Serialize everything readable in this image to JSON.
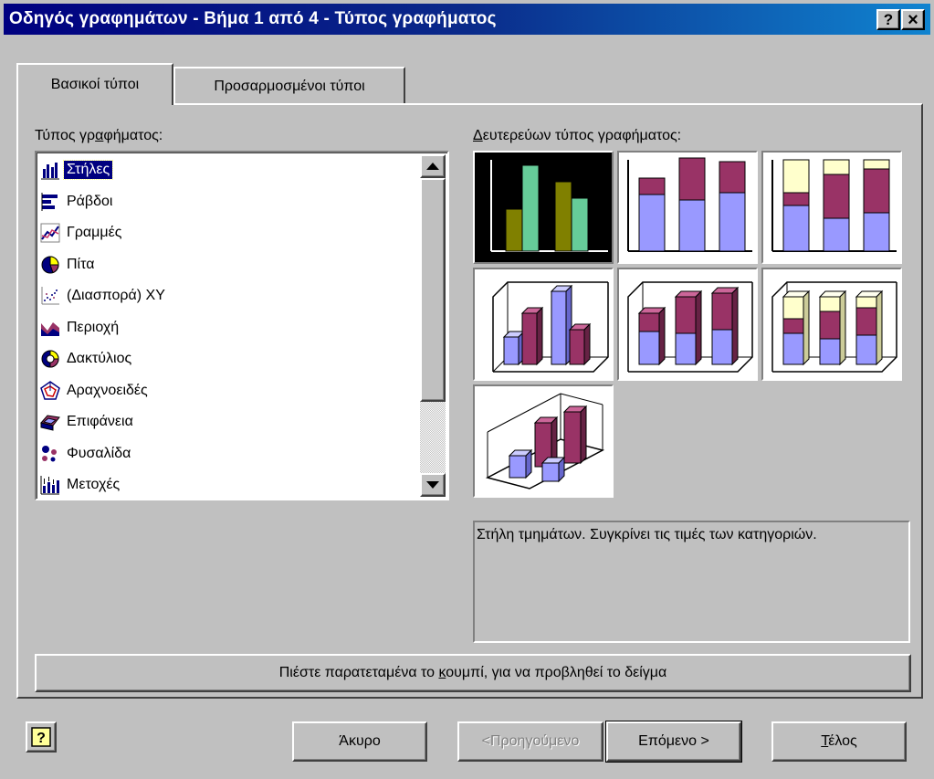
{
  "window": {
    "title": "Οδηγός γραφημάτων - Βήμα 1 από 4 - Τύπος γραφήματος",
    "help_button": "?",
    "close_button": "×"
  },
  "tabs": [
    {
      "label": "Βασικοί τύποι",
      "active": true
    },
    {
      "label": "Προσαρμοσμένοι τύποι",
      "active": false
    }
  ],
  "chart_type": {
    "label_pre": "Τύπος γρ",
    "label_accel": "α",
    "label_post": "φήματος:",
    "items": [
      {
        "label": "Στήλες",
        "icon": "column-chart-icon",
        "selected": true
      },
      {
        "label": "Ράβδοι",
        "icon": "bar-chart-icon"
      },
      {
        "label": "Γραμμές",
        "icon": "line-chart-icon"
      },
      {
        "label": "Πίτα",
        "icon": "pie-chart-icon"
      },
      {
        "label": "(Διασπορά) XY",
        "icon": "scatter-chart-icon"
      },
      {
        "label": "Περιοχή",
        "icon": "area-chart-icon"
      },
      {
        "label": "Δακτύλιος",
        "icon": "doughnut-chart-icon"
      },
      {
        "label": "Αραχνοειδές",
        "icon": "radar-chart-icon"
      },
      {
        "label": "Επιφάνεια",
        "icon": "surface-chart-icon"
      },
      {
        "label": "Φυσαλίδα",
        "icon": "bubble-chart-icon"
      },
      {
        "label": "Μετοχές",
        "icon": "stock-chart-icon"
      }
    ]
  },
  "subtype": {
    "label_accel": "Δ",
    "label_post": "ευτερεύων τύπος γραφήματος:",
    "tiles": [
      {
        "icon": "clustered-column-icon",
        "selected": true
      },
      {
        "icon": "stacked-column-icon"
      },
      {
        "icon": "100-stacked-column-icon"
      },
      {
        "icon": "3d-clustered-column-icon"
      },
      {
        "icon": "3d-stacked-column-icon"
      },
      {
        "icon": "3d-100-stacked-column-icon"
      },
      {
        "icon": "3d-column-icon"
      }
    ]
  },
  "description": "Στήλη τμημάτων. Συγκρίνει τις τιμές των κατηγοριών.",
  "sample_button": {
    "pre": "Πιέστε παρατεταμένα το ",
    "accel": "κ",
    "post": "ουμπί, για να προβληθεί το δείγμα"
  },
  "footer": {
    "cancel": "Άκυρο",
    "back": "<Προηγούμενο",
    "next": "Επόμενο >",
    "finish_accel": "Τ",
    "finish_post": "έλος"
  },
  "colors": {
    "title_start": "#000080",
    "title_end": "#1084d0",
    "face": "#c0c0c0",
    "series_blue": "#9999ff",
    "series_purple": "#993366",
    "series_cream": "#ffffcc",
    "olive": "#808000",
    "teal": "#66cc99"
  }
}
